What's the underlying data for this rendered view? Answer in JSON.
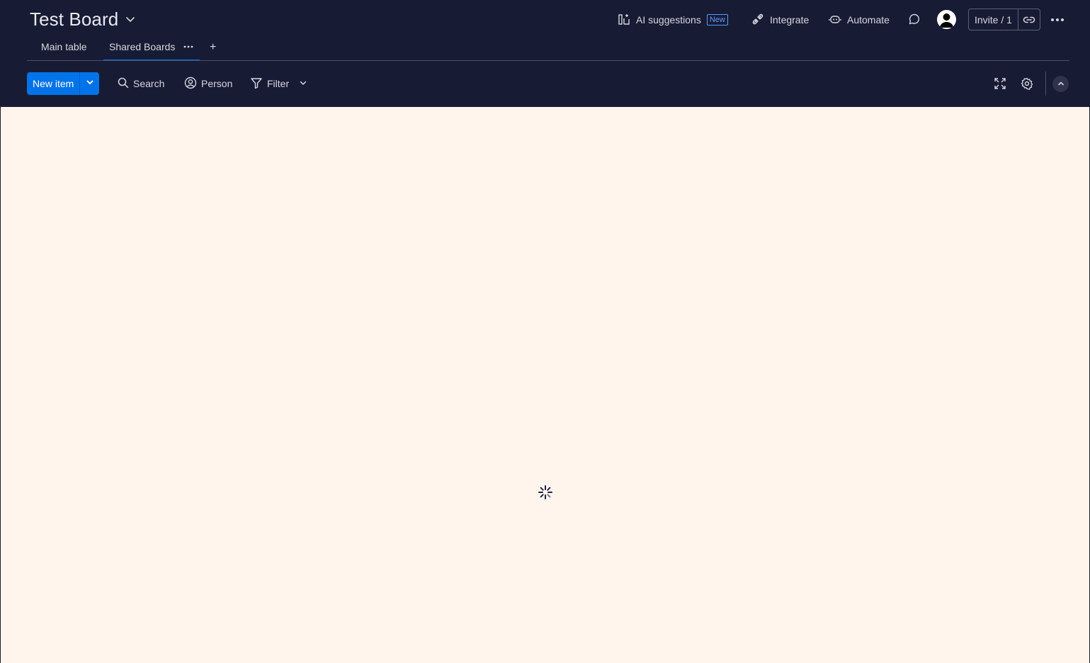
{
  "board": {
    "title": "Test Board"
  },
  "top_actions": {
    "ai_suggestions": "AI suggestions",
    "ai_badge": "New",
    "integrate": "Integrate",
    "automate": "Automate",
    "invite": "Invite / 1"
  },
  "tabs": [
    {
      "label": "Main table",
      "active": false
    },
    {
      "label": "Shared Boards",
      "active": true
    }
  ],
  "tab_add_label": "+",
  "toolbar": {
    "new_item": "New item",
    "search": "Search",
    "person": "Person",
    "filter": "Filter"
  },
  "content": {
    "state": "loading"
  },
  "colors": {
    "header_bg": "#181b34",
    "primary": "#0073ea",
    "content_bg": "#fff5ed",
    "badge": "#579bfc"
  },
  "icons": [
    "chevron-down-icon",
    "ai-suggestions-icon",
    "integrate-icon",
    "automate-icon",
    "chat-icon",
    "avatar",
    "link-icon",
    "more-horizontal-icon",
    "search-icon",
    "person-icon",
    "filter-icon",
    "fullscreen-icon",
    "settings-icon",
    "chevron-up-icon",
    "spinner-icon"
  ]
}
